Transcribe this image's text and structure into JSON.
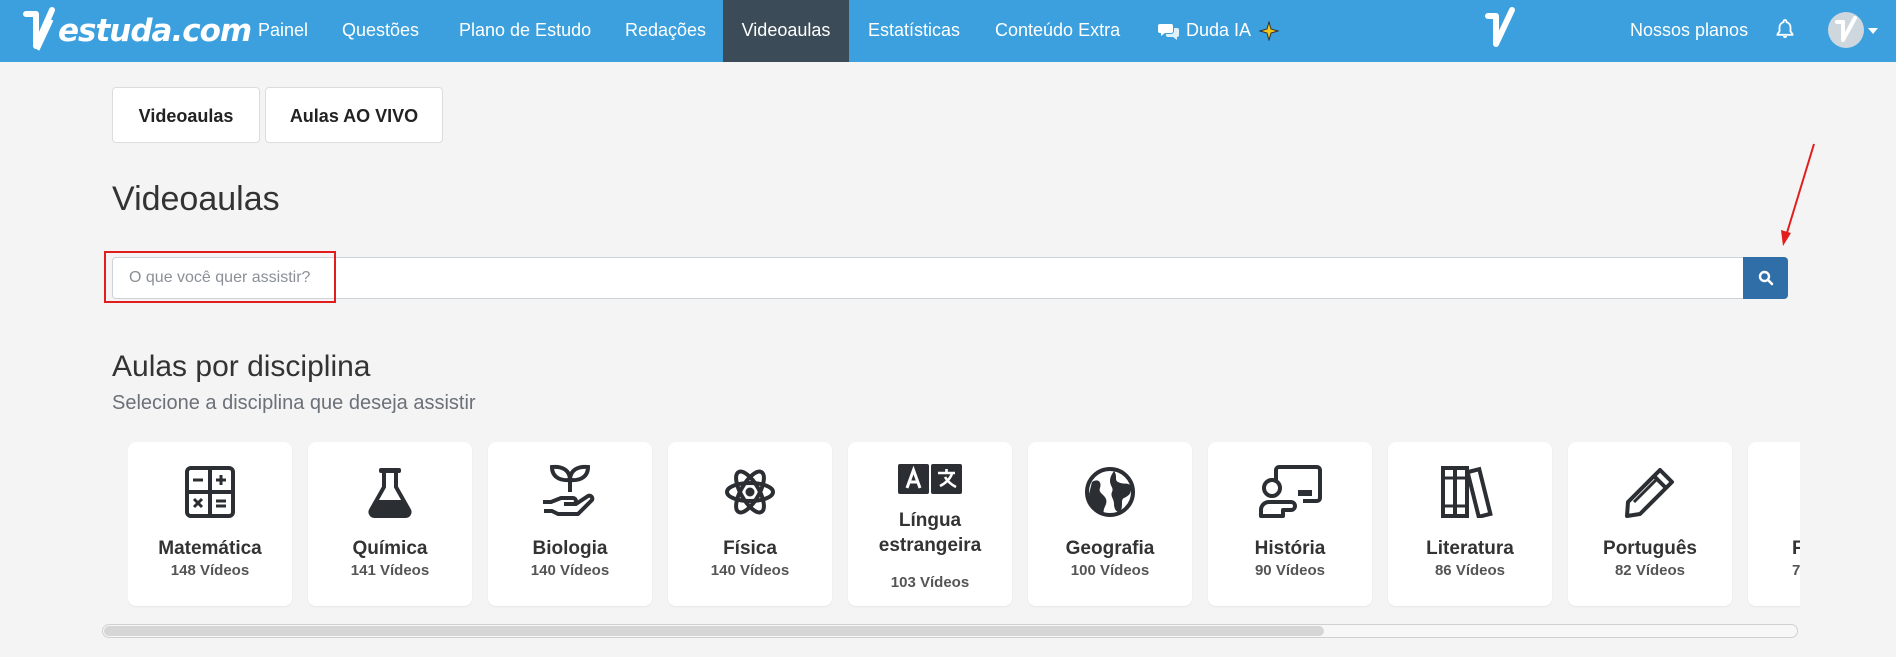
{
  "brand": {
    "logo_text": "estuda.com"
  },
  "nav": {
    "items": [
      {
        "label": "Painel"
      },
      {
        "label": "Questões"
      },
      {
        "label": "Plano de Estudo"
      },
      {
        "label": "Redações"
      },
      {
        "label": "Videoaulas",
        "active": true
      },
      {
        "label": "Estatísticas"
      },
      {
        "label": "Conteúdo Extra"
      },
      {
        "label": "Duda IA"
      }
    ],
    "right_link": "Nossos planos"
  },
  "tabs": [
    {
      "label": "Videoaulas"
    },
    {
      "label": "Aulas AO VIVO"
    }
  ],
  "page": {
    "title": "Videoaulas",
    "search_placeholder": "O que você quer assistir?"
  },
  "section": {
    "title": "Aulas por disciplina",
    "subtitle": "Selecione a disciplina que deseja assistir"
  },
  "disciplines": [
    {
      "name": "Matemática",
      "count": "148 Vídeos",
      "icon": "calculator-icon"
    },
    {
      "name": "Química",
      "count": "141 Vídeos",
      "icon": "flask-icon"
    },
    {
      "name": "Biologia",
      "count": "140 Vídeos",
      "icon": "seedling-icon"
    },
    {
      "name": "Física",
      "count": "140 Vídeos",
      "icon": "atom-icon"
    },
    {
      "name": "Língua estrangeira",
      "count": "103 Vídeos",
      "icon": "language-icon"
    },
    {
      "name": "Geografia",
      "count": "100 Vídeos",
      "icon": "globe-icon"
    },
    {
      "name": "História",
      "count": "90 Vídeos",
      "icon": "chalkboard-teacher-icon"
    },
    {
      "name": "Literatura",
      "count": "86 Vídeos",
      "icon": "books-icon"
    },
    {
      "name": "Português",
      "count": "82 Vídeos",
      "icon": "pencil-icon"
    },
    {
      "name": "F",
      "count": "7",
      "icon": "partial-card"
    }
  ],
  "colors": {
    "nav_bg": "#3ba0dd",
    "nav_active": "#3b4b57",
    "search_button": "#2f6ea6",
    "highlight": "#e11d1d"
  }
}
